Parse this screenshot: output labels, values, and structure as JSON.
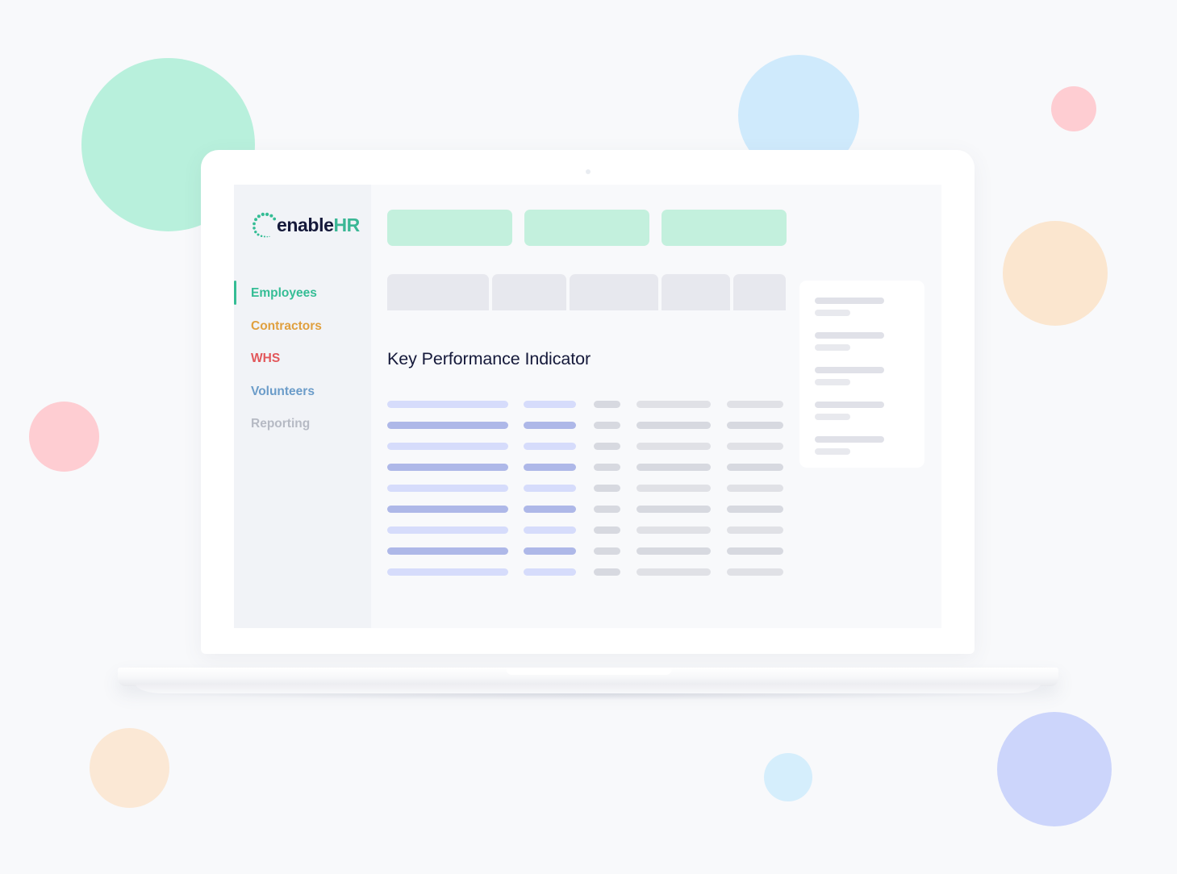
{
  "background": {
    "page_color": "#f8f9fb",
    "blobs": [
      {
        "name": "mint-circle",
        "color": "#b8f0dc"
      },
      {
        "name": "sky-circle-top",
        "color": "#cfeafc"
      },
      {
        "name": "pink-circle-small",
        "color": "#fecdd2"
      },
      {
        "name": "peach-circle-right",
        "color": "#fbe6cf"
      },
      {
        "name": "pink-circle-left",
        "color": "#fecdd2"
      },
      {
        "name": "peach-circle-left",
        "color": "#fbe8d5"
      },
      {
        "name": "sky-circle-small",
        "color": "#d5eefc"
      },
      {
        "name": "periwinkle-circle",
        "color": "#ccd5fb"
      }
    ]
  },
  "device": {
    "type": "laptop",
    "camera_icon": "camera-dot-icon"
  },
  "app": {
    "logo": {
      "icon": "enablehr-dotted-arc-icon",
      "text_primary": "enable",
      "text_accent": "HR",
      "color_primary": "#15193a",
      "color_accent": "#3ab795"
    },
    "sidebar": {
      "background": "#f1f3f7",
      "items": [
        {
          "label": "Employees",
          "color": "#35bd95",
          "active": true
        },
        {
          "label": "Contractors",
          "color": "#e0a03f",
          "active": false
        },
        {
          "label": "WHS",
          "color": "#e2575b",
          "active": false
        },
        {
          "label": "Volunteers",
          "color": "#6b9cc9",
          "active": false
        },
        {
          "label": "Reporting",
          "color": "#b6bac4",
          "active": false
        }
      ],
      "active_indicator_color": "#35bd95"
    },
    "main": {
      "summary_cards": [
        {
          "name": "summary-card-1",
          "color": "#c3f0dd"
        },
        {
          "name": "summary-card-2",
          "color": "#c3f0dd"
        },
        {
          "name": "summary-card-3",
          "color": "#c3f0dd"
        }
      ],
      "tabs": [
        {
          "name": "tab-placeholder-1",
          "color": "#e7e8ee"
        },
        {
          "name": "tab-placeholder-2",
          "color": "#e7e8ee"
        },
        {
          "name": "tab-placeholder-3",
          "color": "#e7e8ee"
        },
        {
          "name": "tab-placeholder-4",
          "color": "#e7e8ee"
        },
        {
          "name": "tab-placeholder-5",
          "color": "#e7e8ee"
        }
      ],
      "section_title": "Key Performance Indicator",
      "table": {
        "row_count": 9,
        "column_count": 5,
        "colors": {
          "blue_light": "#d6dcfb",
          "blue_dark": "#aeb8e8",
          "gray_light": "#e0e1e6",
          "gray_dark": "#d7d9e0"
        },
        "rows": [
          {
            "shade": "light"
          },
          {
            "shade": "dark"
          },
          {
            "shade": "light"
          },
          {
            "shade": "dark"
          },
          {
            "shade": "light"
          },
          {
            "shade": "dark"
          },
          {
            "shade": "light"
          },
          {
            "shade": "dark"
          },
          {
            "shade": "light"
          }
        ]
      },
      "side_panel": {
        "background": "#ffffff",
        "group_count": 5,
        "groups": [
          {
            "name": "panel-item-1"
          },
          {
            "name": "panel-item-2"
          },
          {
            "name": "panel-item-3"
          },
          {
            "name": "panel-item-4"
          },
          {
            "name": "panel-item-5"
          }
        ]
      }
    }
  }
}
